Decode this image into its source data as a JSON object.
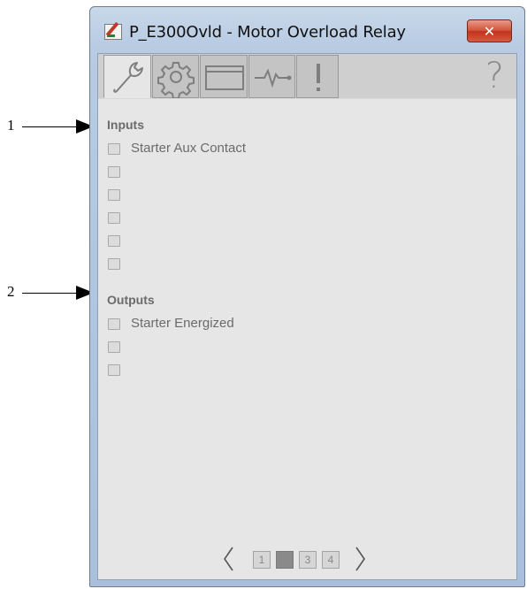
{
  "callouts": [
    {
      "label": "1"
    },
    {
      "label": "2"
    }
  ],
  "window": {
    "title": "P_E300Ovld - Motor Overload Relay",
    "close_label": "✕",
    "app_icon": "faceplate-app-icon"
  },
  "toolbar": {
    "tabs": [
      {
        "name": "maintenance",
        "icon": "wrench-icon",
        "active": true
      },
      {
        "name": "engineering",
        "icon": "gear-icon",
        "active": false
      },
      {
        "name": "diagnostics",
        "icon": "window-icon",
        "active": false
      },
      {
        "name": "trends",
        "icon": "trend-icon",
        "active": false
      },
      {
        "name": "alarms",
        "icon": "exclamation-icon",
        "active": false
      }
    ],
    "help_label": "?"
  },
  "inputs": {
    "heading": "Inputs",
    "items": [
      {
        "label": "Starter Aux Contact",
        "checked": false
      },
      {
        "label": "",
        "checked": false
      },
      {
        "label": "",
        "checked": false
      },
      {
        "label": "",
        "checked": false
      },
      {
        "label": "",
        "checked": false
      },
      {
        "label": "",
        "checked": false
      }
    ]
  },
  "outputs": {
    "heading": "Outputs",
    "items": [
      {
        "label": "Starter Energized",
        "checked": false
      },
      {
        "label": "",
        "checked": false
      },
      {
        "label": "",
        "checked": false
      }
    ]
  },
  "pager": {
    "prev_label": "〈",
    "next_label": "〉",
    "pages": [
      "1",
      "2",
      "3",
      "4"
    ],
    "current_page": "2"
  }
}
